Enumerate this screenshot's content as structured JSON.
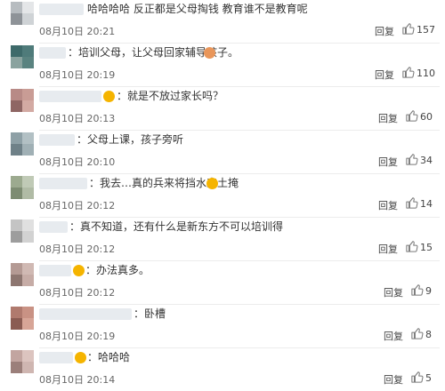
{
  "comments": [
    {
      "text": "哈哈哈哈 反正都是父母掏钱 教育谁不是教育呢",
      "time": "08月10日 20:21",
      "reply": "回复",
      "likes": "157"
    },
    {
      "text": "：培训父母，让父母回家辅导孩子。",
      "time": "08月10日 20:19",
      "reply": "回复",
      "likes": "110"
    },
    {
      "text": "：就是不放过家长吗？",
      "time": "08月10日 20:13",
      "reply": "回复",
      "likes": "60"
    },
    {
      "text": "：父母上课，孩子旁听",
      "time": "08月10日 20:10",
      "reply": "回复",
      "likes": "34"
    },
    {
      "text": "：我去…真的兵来将挡水来土掩",
      "time": "08月10日 20:12",
      "reply": "回复",
      "likes": "14"
    },
    {
      "text": "：真不知道，还有什么是新东方不可以培训得",
      "time": "08月10日 20:12",
      "reply": "回复",
      "likes": "15"
    },
    {
      "text": "：办法真多。",
      "time": "08月10日 20:12",
      "reply": "回复",
      "likes": "9"
    },
    {
      "text": "：卧槽",
      "time": "08月10日 20:19",
      "reply": "回复",
      "likes": "8"
    },
    {
      "text": "：哈哈哈",
      "time": "08月10日 20:14",
      "reply": "回复",
      "likes": "5"
    }
  ],
  "icons": {
    "like": "thumbs-up-icon",
    "emoji_smile": "smile-emoji-icon",
    "emoji_laugh": "laugh-emoji-icon",
    "emoji_victory": "victory-emoji-icon",
    "emoji_sweat": "sweat-emoji-icon"
  },
  "colors": {
    "text": "#333333",
    "meta": "#666666",
    "like_icon": "#7a7a7a",
    "emoji": "#f5b400"
  }
}
